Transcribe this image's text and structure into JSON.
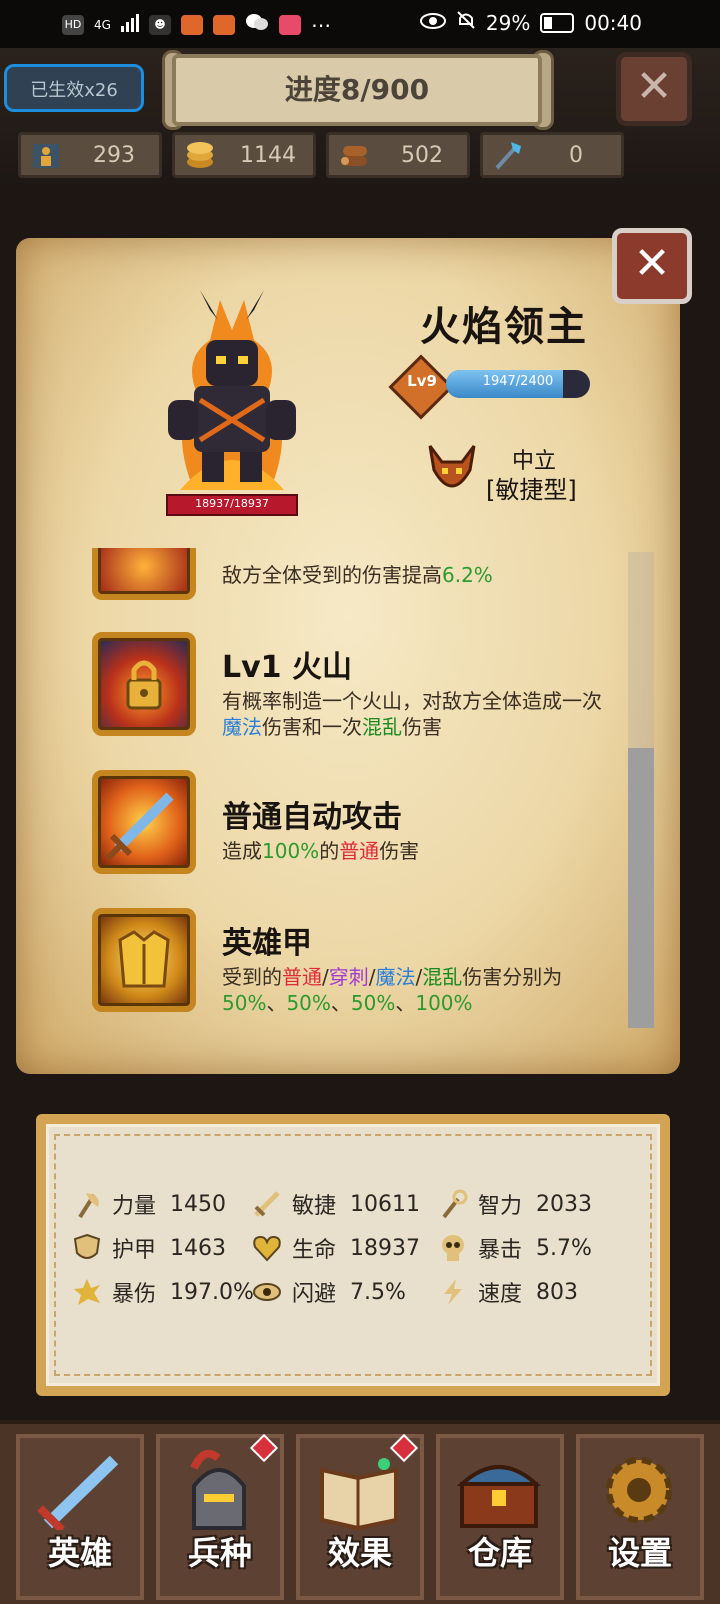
{
  "status_bar": {
    "network": "4G",
    "battery": "29%",
    "time": "00:40"
  },
  "top_bar": {
    "buff_badge": "已生效x26",
    "progress": "进度8/900",
    "resources": [
      {
        "icon": "population-icon",
        "value": "293"
      },
      {
        "icon": "gold-coins-icon",
        "value": "1144"
      },
      {
        "icon": "wood-logs-icon",
        "value": "502"
      },
      {
        "icon": "crystal-staff-icon",
        "value": "0"
      }
    ]
  },
  "hero": {
    "name": "火焰领主",
    "level": "Lv9",
    "xp": {
      "current": 1947,
      "max": 2400,
      "text": "1947/2400"
    },
    "hp_text": "18937/18937",
    "faction": "中立",
    "type": "[敏捷型]"
  },
  "skills": [
    {
      "title": "",
      "desc_parts": [
        {
          "text": "敌方全体受到的伤害提高",
          "color": "default"
        },
        {
          "text": "6.2%",
          "color": "green"
        }
      ],
      "icon": "flame-pit-icon"
    },
    {
      "title": "Lv1 火山",
      "desc_parts": [
        {
          "text": "有概率制造一个火山，对敌方全体造成一次",
          "color": "default"
        },
        {
          "text": "魔法",
          "color": "blue"
        },
        {
          "text": "伤害和一次",
          "color": "default"
        },
        {
          "text": "混乱",
          "color": "dgreen"
        },
        {
          "text": "伤害",
          "color": "default"
        }
      ],
      "icon": "volcano-locked-icon"
    },
    {
      "title": "普通自动攻击",
      "desc_parts": [
        {
          "text": "造成",
          "color": "default"
        },
        {
          "text": "100%",
          "color": "green"
        },
        {
          "text": "的",
          "color": "default"
        },
        {
          "text": "普通",
          "color": "red"
        },
        {
          "text": "伤害",
          "color": "default"
        }
      ],
      "icon": "sword-icon"
    },
    {
      "title": "英雄甲",
      "desc_parts": [
        {
          "text": "受到的",
          "color": "default"
        },
        {
          "text": "普通",
          "color": "red"
        },
        {
          "text": "/",
          "color": "default"
        },
        {
          "text": "穿刺",
          "color": "purple"
        },
        {
          "text": "/",
          "color": "default"
        },
        {
          "text": "魔法",
          "color": "blue"
        },
        {
          "text": "/",
          "color": "default"
        },
        {
          "text": "混乱",
          "color": "dgreen"
        },
        {
          "text": "伤害分别为",
          "color": "default"
        },
        {
          "text": "50%",
          "color": "green"
        },
        {
          "text": "、",
          "color": "default"
        },
        {
          "text": "50%",
          "color": "green"
        },
        {
          "text": "、",
          "color": "default"
        },
        {
          "text": "50%",
          "color": "green"
        },
        {
          "text": "、",
          "color": "default"
        },
        {
          "text": "100%",
          "color": "green"
        }
      ],
      "icon": "golden-armor-icon"
    }
  ],
  "stats": [
    {
      "icon": "axe-icon",
      "label": "力量",
      "value": "1450"
    },
    {
      "icon": "sword-icon",
      "label": "敏捷",
      "value": "10611"
    },
    {
      "icon": "staff-icon",
      "label": "智力",
      "value": "2033"
    },
    {
      "icon": "shield-icon",
      "label": "护甲",
      "value": "1463"
    },
    {
      "icon": "heart-icon",
      "label": "生命",
      "value": "18937"
    },
    {
      "icon": "skull-icon",
      "label": "暴击",
      "value": "5.7%"
    },
    {
      "icon": "burst-icon",
      "label": "暴伤",
      "value": "197.0%"
    },
    {
      "icon": "eye-icon",
      "label": "闪避",
      "value": "7.5%"
    },
    {
      "icon": "lightning-icon",
      "label": "速度",
      "value": "803"
    }
  ],
  "nav": [
    {
      "label": "英雄",
      "icon": "sword-icon",
      "badge": false
    },
    {
      "label": "兵种",
      "icon": "knight-helmet-icon",
      "badge": true
    },
    {
      "label": "效果",
      "icon": "spellbook-icon",
      "badge": true
    },
    {
      "label": "仓库",
      "icon": "treasure-chest-icon",
      "badge": false
    },
    {
      "label": "设置",
      "icon": "gear-icon",
      "badge": false
    }
  ],
  "colors": {
    "green": "#2e9a2e",
    "red": "#e02a3a",
    "blue": "#2a7fd8",
    "purple": "#a23ad0",
    "dgreen": "#1b8a20"
  }
}
